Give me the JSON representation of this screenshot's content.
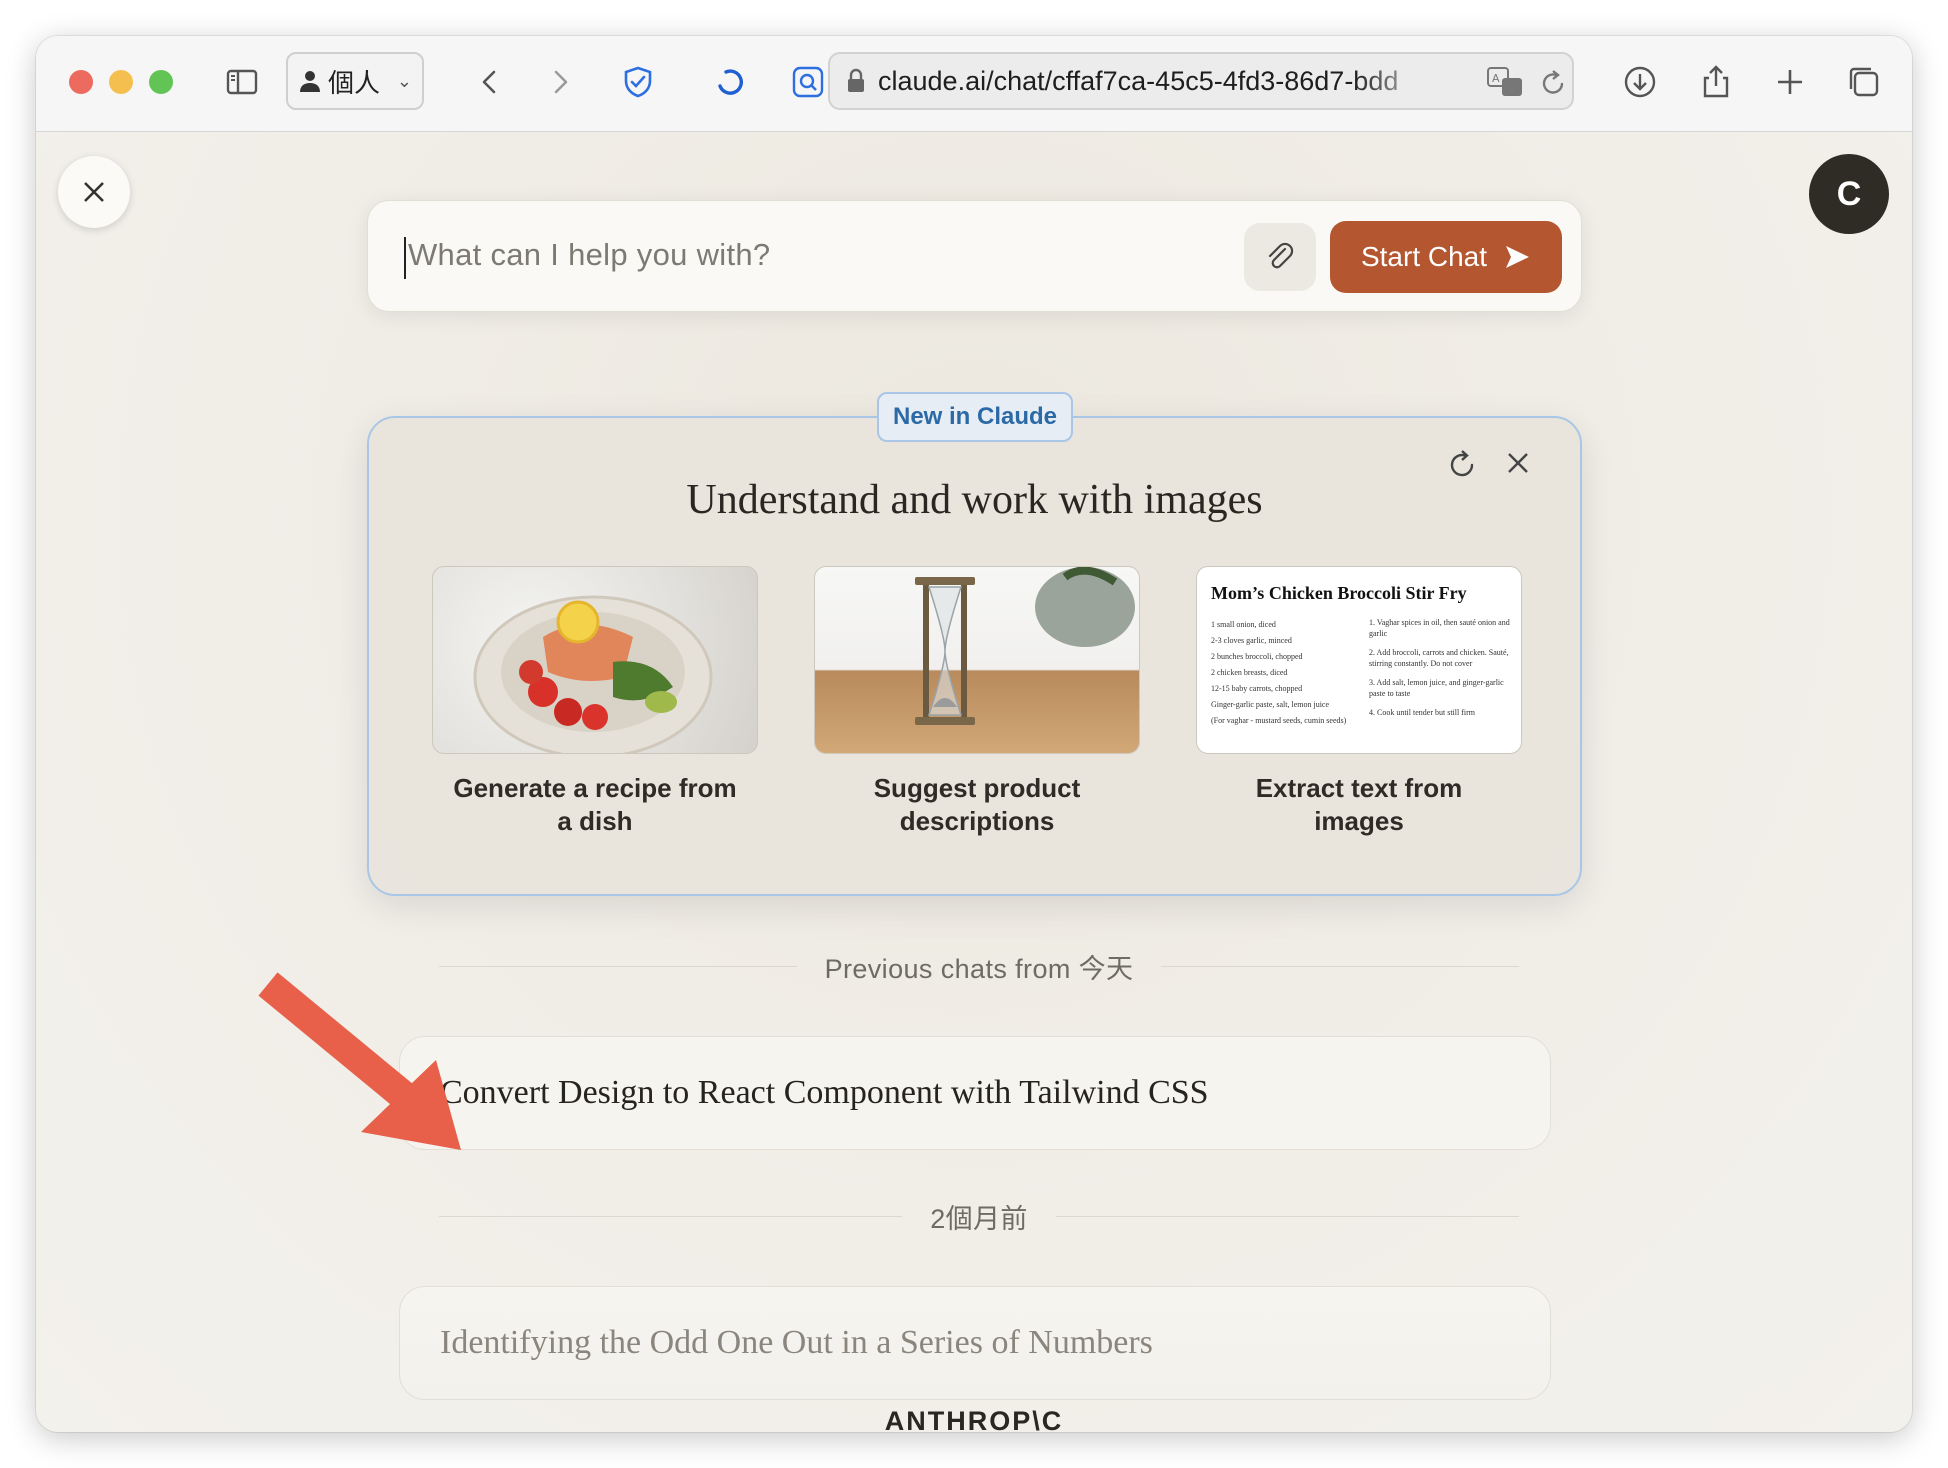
{
  "browser": {
    "profile_label": "個人",
    "url": "claude.ai/chat/cffaf7ca-45c5-4fd3-86d7-bdd"
  },
  "user": {
    "avatar_initial": "C"
  },
  "composer": {
    "placeholder": "What can I help you with?",
    "start_label": "Start Chat"
  },
  "announcement": {
    "badge": "New in Claude",
    "title": "Understand and work with images",
    "features": [
      {
        "label_line1": "Generate a recipe from",
        "label_line2": "a dish"
      },
      {
        "label_line1": "Suggest product",
        "label_line2": "descriptions"
      },
      {
        "label_line1": "Extract text from",
        "label_line2": "images"
      }
    ],
    "recipe_doc": {
      "title": "Mom’s Chicken Broccoli Stir Fry",
      "ingredients": [
        "1 small onion, diced",
        "2-3 cloves garlic, minced",
        "2 bunches broccoli, chopped",
        "2 chicken breasts, diced",
        "12-15 baby carrots, chopped",
        "Ginger-garlic paste, salt, lemon juice",
        "(For vaghar - mustard seeds, cumin seeds)"
      ],
      "steps": [
        "1. Vaghar spices in oil, then sauté onion and garlic",
        "2. Add broccoli, carrots and chicken. Sauté, stirring constantly. Do not cover",
        "3. Add salt, lemon juice, and ginger-garlic paste to taste",
        "4. Cook until tender but still firm"
      ]
    }
  },
  "history": {
    "today_heading": "Previous chats from 今天",
    "today_chat": "Convert Design to React Component with Tailwind CSS",
    "older_heading": "2個月前",
    "older_chat": "Identifying the Odd One Out in a Series of Numbers"
  },
  "footer": {
    "brand": "ANTHROP\\C"
  },
  "colors": {
    "accent": "#b4562f",
    "badge_blue": "#2c6aa6",
    "arrow": "#e8604a"
  }
}
